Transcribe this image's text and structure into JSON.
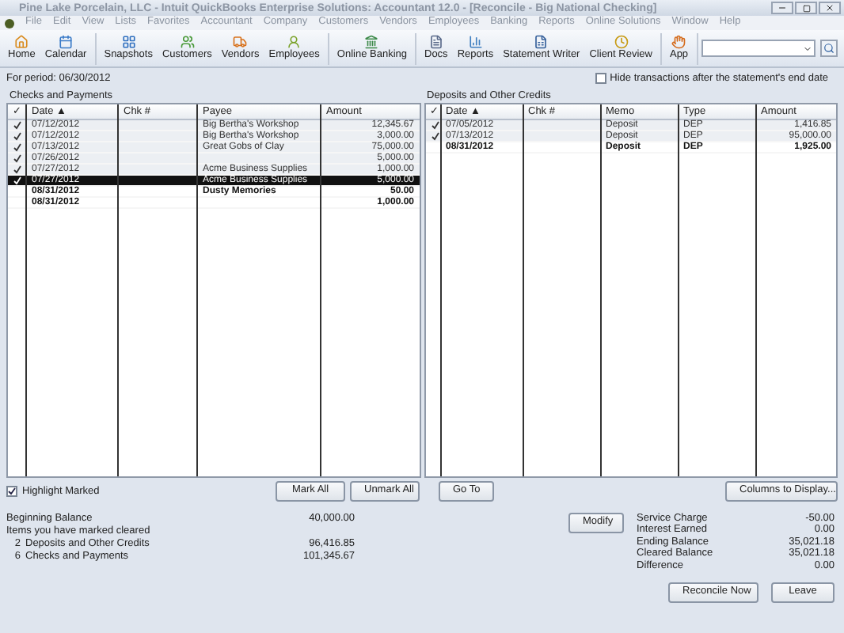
{
  "window": {
    "title": "Pine Lake Porcelain, LLC  - Intuit QuickBooks Enterprise Solutions: Accountant 12.0 - [Reconcile - Big National Checking]"
  },
  "menu": [
    "File",
    "Edit",
    "View",
    "Lists",
    "Favorites",
    "Accountant",
    "Company",
    "Customers",
    "Vendors",
    "Employees",
    "Banking",
    "Reports",
    "Online Solutions",
    "Window",
    "Help"
  ],
  "toolbar": [
    [
      "Home",
      "Calendar"
    ],
    [
      "Snapshots",
      "Customers",
      "Vendors",
      "Employees"
    ],
    [
      "Online Banking"
    ],
    [
      "Docs",
      "Reports",
      "Statement Writer",
      "Client Review"
    ],
    [
      "App"
    ]
  ],
  "period": "For period: 06/30/2012",
  "hide_option": {
    "label": "Hide transactions after the statement's end date",
    "checked": false
  },
  "checks": {
    "title": "Checks and Payments",
    "columns": [
      "✓",
      "Date ▲",
      "Chk #",
      "Payee",
      "Amount"
    ],
    "rows": [
      {
        "cleared": true,
        "selected": false,
        "date": "07/12/2012",
        "name": "Big Bertha's Workshop",
        "amount": "12,345.67"
      },
      {
        "cleared": true,
        "selected": false,
        "date": "07/12/2012",
        "name": "Big Bertha's Workshop",
        "amount": "3,000.00"
      },
      {
        "cleared": true,
        "selected": false,
        "date": "07/13/2012",
        "name": "Great Gobs of Clay",
        "amount": "75,000.00"
      },
      {
        "cleared": true,
        "selected": false,
        "date": "07/26/2012",
        "amount": "5,000.00"
      },
      {
        "cleared": true,
        "selected": false,
        "date": "07/27/2012",
        "name": "Acme Business Supplies",
        "amount": "1,000.00"
      },
      {
        "cleared": true,
        "selected": true,
        "date": "07/27/2012",
        "name": "Acme Business Supplies",
        "amount": "5,000.00"
      },
      {
        "cleared": false,
        "selected": false,
        "date": "08/31/2012",
        "name": "Dusty Memories",
        "amount": "50.00"
      },
      {
        "cleared": false,
        "selected": false,
        "date": "08/31/2012",
        "amount": "1,000.00"
      }
    ]
  },
  "deposits": {
    "title": "Deposits and Other Credits",
    "columns": [
      "✓",
      "Date ▲",
      "Chk #",
      "Memo",
      "Type",
      "Amount"
    ],
    "rows": [
      {
        "cleared": true,
        "selected": false,
        "date": "07/05/2012",
        "memo": "Deposit",
        "type": "DEP",
        "amount": "1,416.85"
      },
      {
        "cleared": true,
        "selected": false,
        "date": "07/13/2012",
        "memo": "Deposit",
        "type": "DEP",
        "amount": "95,000.00"
      },
      {
        "cleared": false,
        "selected": false,
        "date": "08/31/2012",
        "memo": "Deposit",
        "type": "DEP",
        "amount": "1,925.00"
      }
    ]
  },
  "highlight_marked": {
    "label": "Highlight Marked",
    "checked": true
  },
  "buttons_left": [
    "Mark All",
    "Unmark All"
  ],
  "buttons_right_left": [
    "Go To"
  ],
  "columns_button": "Columns to Display...",
  "summary_left": [
    {
      "label": "Beginning Balance",
      "value": "40,000.00"
    },
    {
      "label": "Items you have marked cleared"
    },
    {
      "label": "Deposits and Other Credits",
      "count": "2",
      "value": "96,416.85"
    },
    {
      "label": "Checks and Payments",
      "count": "6",
      "value": "101,345.67"
    }
  ],
  "modify_button": "Modify",
  "summary_right": [
    {
      "label": "Service Charge",
      "value": "-50.00"
    },
    {
      "label": "Interest Earned",
      "value": "0.00"
    },
    {
      "label": "Ending Balance",
      "value": "35,021.18"
    },
    {
      "label": "Cleared Balance",
      "value": "35,021.18"
    },
    {
      "label": "Difference",
      "value": "0.00"
    }
  ],
  "action_buttons": [
    "Reconcile Now",
    "Leave"
  ]
}
